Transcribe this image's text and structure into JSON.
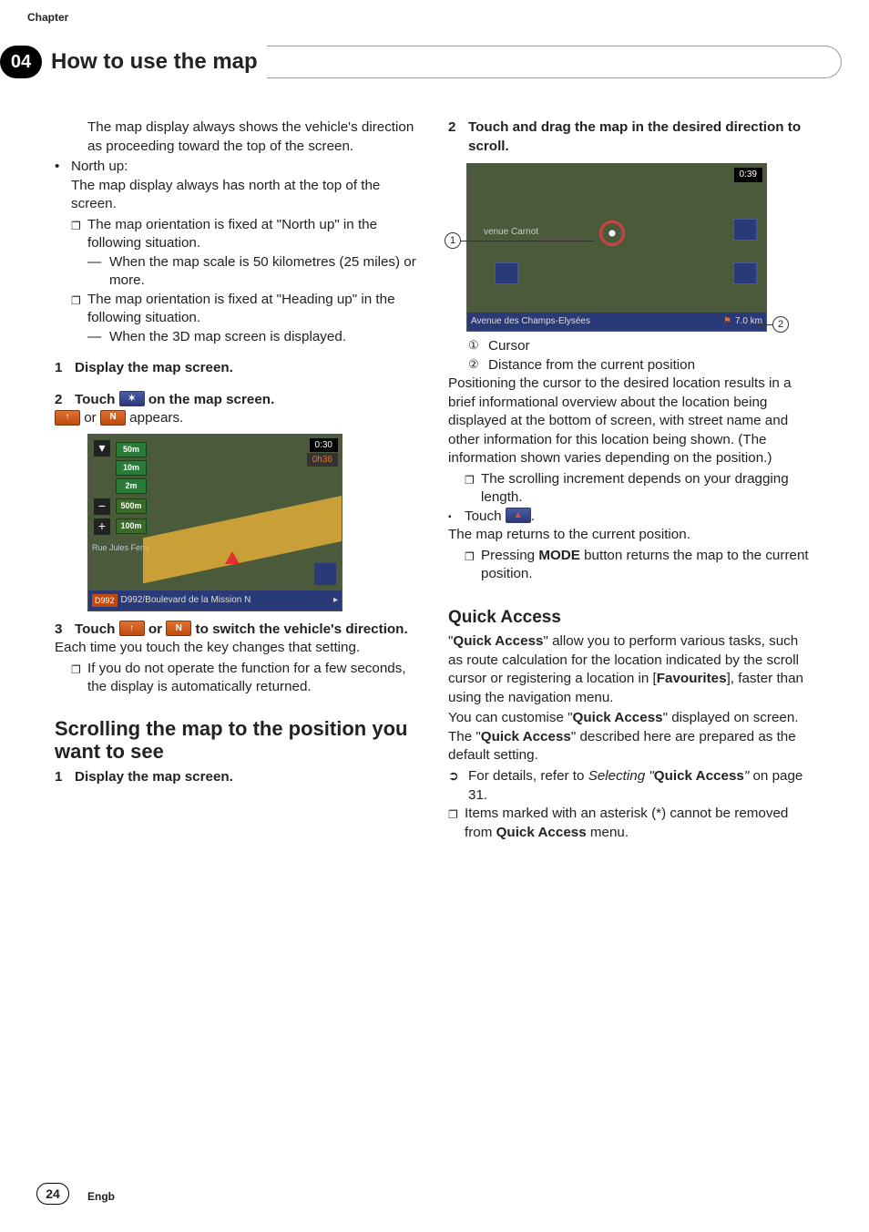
{
  "header": {
    "chapter_label": "Chapter",
    "chapter_num": "04",
    "title": "How to use the map"
  },
  "left": {
    "p1a": "The map display always shows the vehicle's direction as proceeding toward the top of the screen.",
    "bul1": "North up:",
    "bul1_body": "The map display always has north at the top of the screen.",
    "box1": "The map orientation is fixed at \"North up\" in the following situation.",
    "dash1": "When the map scale is 50 kilometres (25 miles) or more.",
    "box2": "The map orientation is fixed at \"Heading up\" in the following situation.",
    "dash2": "When the 3D map screen is displayed.",
    "step1": {
      "n": "1",
      "t": "Display the map screen."
    },
    "step2": {
      "n": "2",
      "pre": "Touch ",
      "post": " on the map screen."
    },
    "step2_body_mid": " or ",
    "step2_body_end": " appears.",
    "sshot1": {
      "time": "0:30",
      "time2": "0h36",
      "s50": "50m",
      "s10": "10m",
      "s2": "2m",
      "s500": "500m",
      "s100": "100m",
      "road_tag": "D992",
      "road_name": "D992/Boulevard de la Mission N",
      "street_small": "Rue Jules Ferry"
    },
    "step3": {
      "n": "3",
      "pre": "Touch ",
      "mid": " or ",
      "post": " to switch the vehicle's direction."
    },
    "step3_body": "Each time you touch the key changes that setting.",
    "step3_note": "If you do not operate the function for a few seconds, the display is automatically returned.",
    "h2": "Scrolling the map to the position you want to see",
    "step_b1": {
      "n": "1",
      "t": "Display the map screen."
    }
  },
  "right": {
    "step2": {
      "n": "2",
      "t": "Touch and drag the map in the desired direction to scroll."
    },
    "sshot2": {
      "time": "0:39",
      "street1": "venue Carnot",
      "bottom_left": "Avenue des Champs-Elysées",
      "bottom_right": "7.0 km"
    },
    "call1": "1",
    "call2": "2",
    "leg1": "Cursor",
    "leg2": "Distance from the current position",
    "para1": "Positioning the cursor to the desired location results in a brief informational overview about the location being displayed at the bottom of screen, with street name and other information for this location being shown. (The information shown varies depending on the position.)",
    "box1": "The scrolling increment depends on your dragging length.",
    "sq1_pre": "Touch ",
    "sq1_post": ".",
    "sq1_body": "The map returns to the current position.",
    "box2a": "Pressing ",
    "box2b": "MODE",
    "box2c": " button returns the map to the current position.",
    "h3": "Quick Access",
    "qa1a": "\"",
    "qa1b": "Quick Access",
    "qa1c": "\" allow you to perform various tasks, such as route calculation for the location indicated by the scroll cursor or registering a location in [",
    "qa1d": "Favourites",
    "qa1e": "], faster than using the navigation menu.",
    "qa2a": "You can customise \"",
    "qa2b": "Quick Access",
    "qa2c": "\" displayed on screen. The \"",
    "qa2d": "Quick Access",
    "qa2e": "\" described here are prepared as the default setting.",
    "arrow1a": "For details, refer to ",
    "arrow1b": "Selecting \"",
    "arrow1c": "Quick Access",
    "arrow1d": "\"",
    "arrow1e": " on page 31.",
    "box3a": "Items marked with an asterisk (*) cannot be removed from ",
    "box3b": "Quick Access",
    "box3c": " menu."
  },
  "footer": {
    "page": "24",
    "lang": "Engb"
  },
  "icons": {
    "heading_arrow": "↑",
    "north": "N",
    "compass": "✶",
    "car": "▲"
  }
}
